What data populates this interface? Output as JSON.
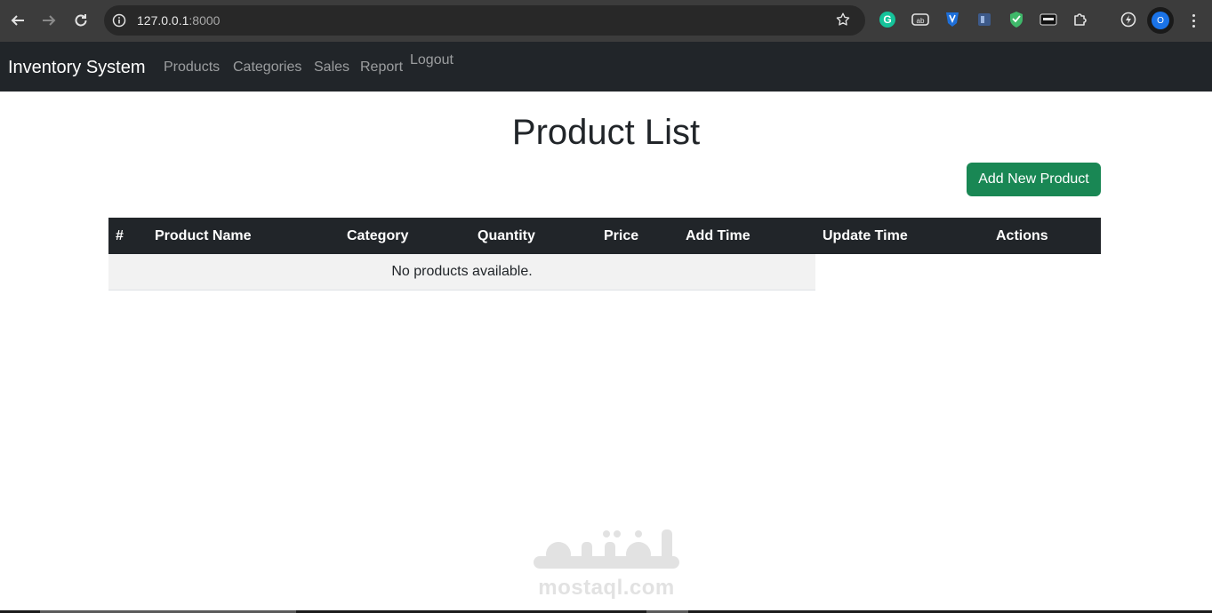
{
  "browser": {
    "url_host": "127.0.0.1",
    "url_port": ":8000",
    "profile_initial": "O",
    "extensions": [
      "grammarly-icon",
      "translate-icon",
      "shield-icon",
      "reader-icon",
      "vpn-shield-icon",
      "ticket-icon",
      "puzzle-extensions-icon",
      "speed-icon"
    ]
  },
  "navbar": {
    "brand": "Inventory System",
    "links": [
      "Products",
      "Categories",
      "Sales",
      "Report",
      "Logout"
    ]
  },
  "page": {
    "title": "Product List",
    "add_button": "Add New Product"
  },
  "table": {
    "headers": [
      "#",
      "Product Name",
      "Category",
      "Quantity",
      "Price",
      "Add Time",
      "Update Time",
      "Actions"
    ],
    "empty_message": "No products available."
  },
  "watermark": {
    "arabic": "مستقل",
    "latin": "mostaql.com"
  },
  "colors": {
    "navbar_bg": "#212529",
    "button_bg": "#198754",
    "table_head_bg": "#212529",
    "empty_row_bg": "#f2f2f2"
  }
}
